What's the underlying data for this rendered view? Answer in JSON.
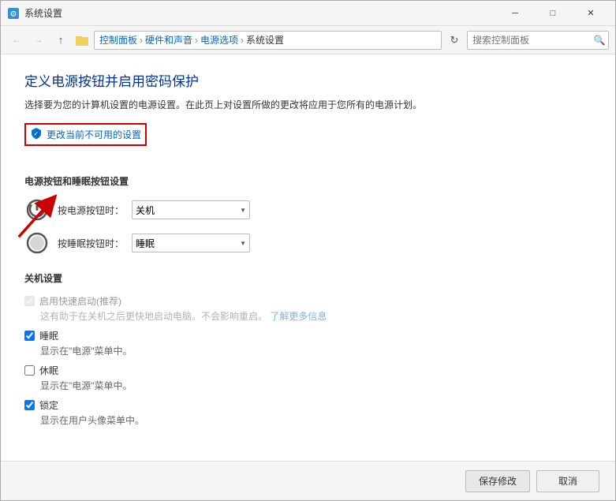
{
  "window": {
    "title": "系统设置",
    "controls": {
      "minimize": "─",
      "maximize": "□",
      "close": "✕"
    }
  },
  "nav": {
    "back_title": "后退",
    "forward_title": "前进",
    "up_title": "向上",
    "refresh_title": "刷新",
    "search_placeholder": "搜索控制面板"
  },
  "breadcrumb": {
    "items": [
      "控制面板",
      "硬件和声音",
      "电源选项",
      "系统设置"
    ],
    "separators": [
      "›",
      "›",
      "›"
    ]
  },
  "page": {
    "title": "定义电源按钮并启用密码保护",
    "subtitle": "选择要为您的计算机设置的电源设置。在此页上对设置所做的更改将应用于您所有的电源计划。",
    "change_settings": "更改当前不可用的设置",
    "power_buttons_title": "电源按钮和睡眠按钮设置",
    "power_button_label": "按电源按钮时：",
    "sleep_button_label": "按睡眠按钮时：",
    "power_button_value": "关机",
    "sleep_button_value": "睡眠",
    "shutdown_title": "关机设置",
    "fast_startup_label": "启用快速启动(推荐)",
    "fast_startup_desc": "这有助于在关机之后更快地启动电脑。不会影响重启。",
    "learn_more": "了解更多信息",
    "sleep_label": "睡眠",
    "sleep_desc": "显示在\"电源\"菜单中。",
    "hibernate_label": "休眠",
    "hibernate_desc": "显示在\"电源\"菜单中。",
    "lock_label": "锁定",
    "lock_desc": "显示在用户头像菜单中。",
    "save_btn": "保存修改",
    "cancel_btn": "取消"
  }
}
